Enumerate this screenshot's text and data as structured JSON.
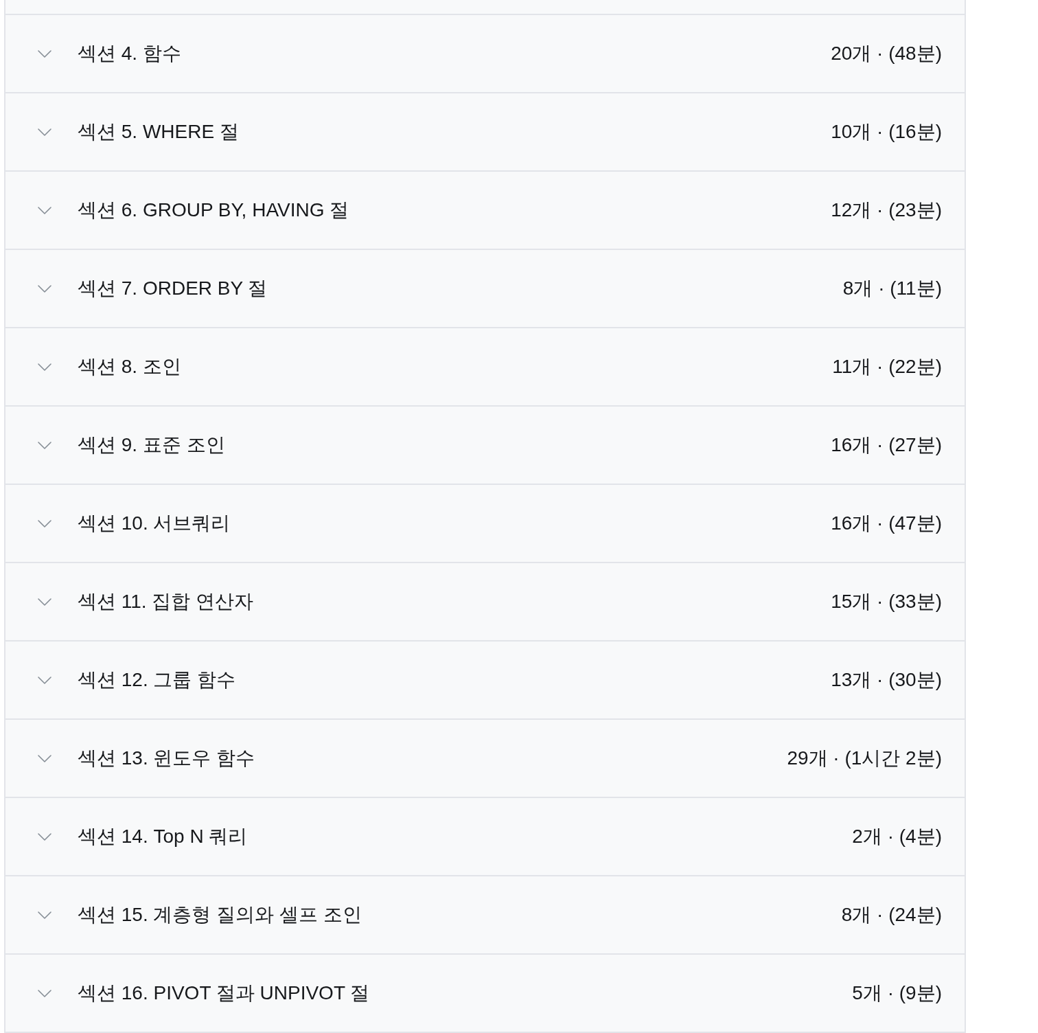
{
  "sections": [
    {
      "title": "섹션 4. 함수",
      "meta": "20개 · (48분)",
      "expanded": false
    },
    {
      "title": "섹션 5. WHERE 절",
      "meta": "10개 · (16분)",
      "expanded": false
    },
    {
      "title": "섹션 6. GROUP BY, HAVING 절",
      "meta": "12개 · (23분)",
      "expanded": false
    },
    {
      "title": "섹션 7. ORDER BY 절",
      "meta": "8개 · (11분)",
      "expanded": false
    },
    {
      "title": "섹션 8. 조인",
      "meta": "11개 · (22분)",
      "expanded": false
    },
    {
      "title": "섹션 9. 표준 조인",
      "meta": "16개 · (27분)",
      "expanded": false
    },
    {
      "title": "섹션 10. 서브쿼리",
      "meta": "16개 · (47분)",
      "expanded": false
    },
    {
      "title": "섹션 11. 집합 연산자",
      "meta": "15개 · (33분)",
      "expanded": false
    },
    {
      "title": "섹션 12. 그룹 함수",
      "meta": "13개 · (30분)",
      "expanded": false
    },
    {
      "title": "섹션 13. 윈도우 함수",
      "meta": "29개 · (1시간 2분)",
      "expanded": false
    },
    {
      "title": "섹션 14. Top N 쿼리",
      "meta": "2개 · (4분)",
      "expanded": false
    },
    {
      "title": "섹션 15. 계층형 질의와 셀프 조인",
      "meta": "8개 · (24분)",
      "expanded": false
    },
    {
      "title": "섹션 16. PIVOT 절과 UNPIVOT 절",
      "meta": "5개 · (9분)",
      "expanded": false
    }
  ]
}
